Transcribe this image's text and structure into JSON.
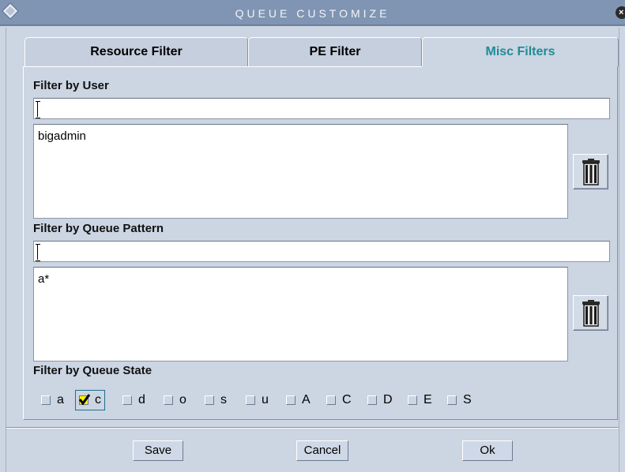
{
  "window": {
    "title": "QUEUE CUSTOMIZE"
  },
  "tabs": [
    {
      "label": "Resource Filter",
      "selected": false
    },
    {
      "label": "PE Filter",
      "selected": false
    },
    {
      "label": "Misc Filters",
      "selected": true
    }
  ],
  "user_filter": {
    "label": "Filter by User",
    "input_value": "",
    "list": [
      "bigadmin"
    ],
    "delete_icon": "trash-icon"
  },
  "queue_pattern_filter": {
    "label": "Filter by Queue Pattern",
    "input_value": "",
    "list": [
      "a*"
    ],
    "delete_icon": "trash-icon"
  },
  "queue_state_filter": {
    "label": "Filter by Queue State",
    "states": [
      {
        "label": "a",
        "checked": false
      },
      {
        "label": "c",
        "checked": true
      },
      {
        "label": "d",
        "checked": false
      },
      {
        "label": "o",
        "checked": false
      },
      {
        "label": "s",
        "checked": false
      },
      {
        "label": "u",
        "checked": false
      },
      {
        "label": "A",
        "checked": false
      },
      {
        "label": "C",
        "checked": false
      },
      {
        "label": "D",
        "checked": false
      },
      {
        "label": "E",
        "checked": false
      },
      {
        "label": "S",
        "checked": false
      }
    ]
  },
  "buttons": {
    "save": "Save",
    "cancel": "Cancel",
    "ok": "Ok"
  },
  "colors": {
    "background": "#ccd5e2",
    "titlebar": "#8095b3",
    "selected_tab_text": "#1e8c96",
    "checkbox_checked": "#fff200"
  }
}
